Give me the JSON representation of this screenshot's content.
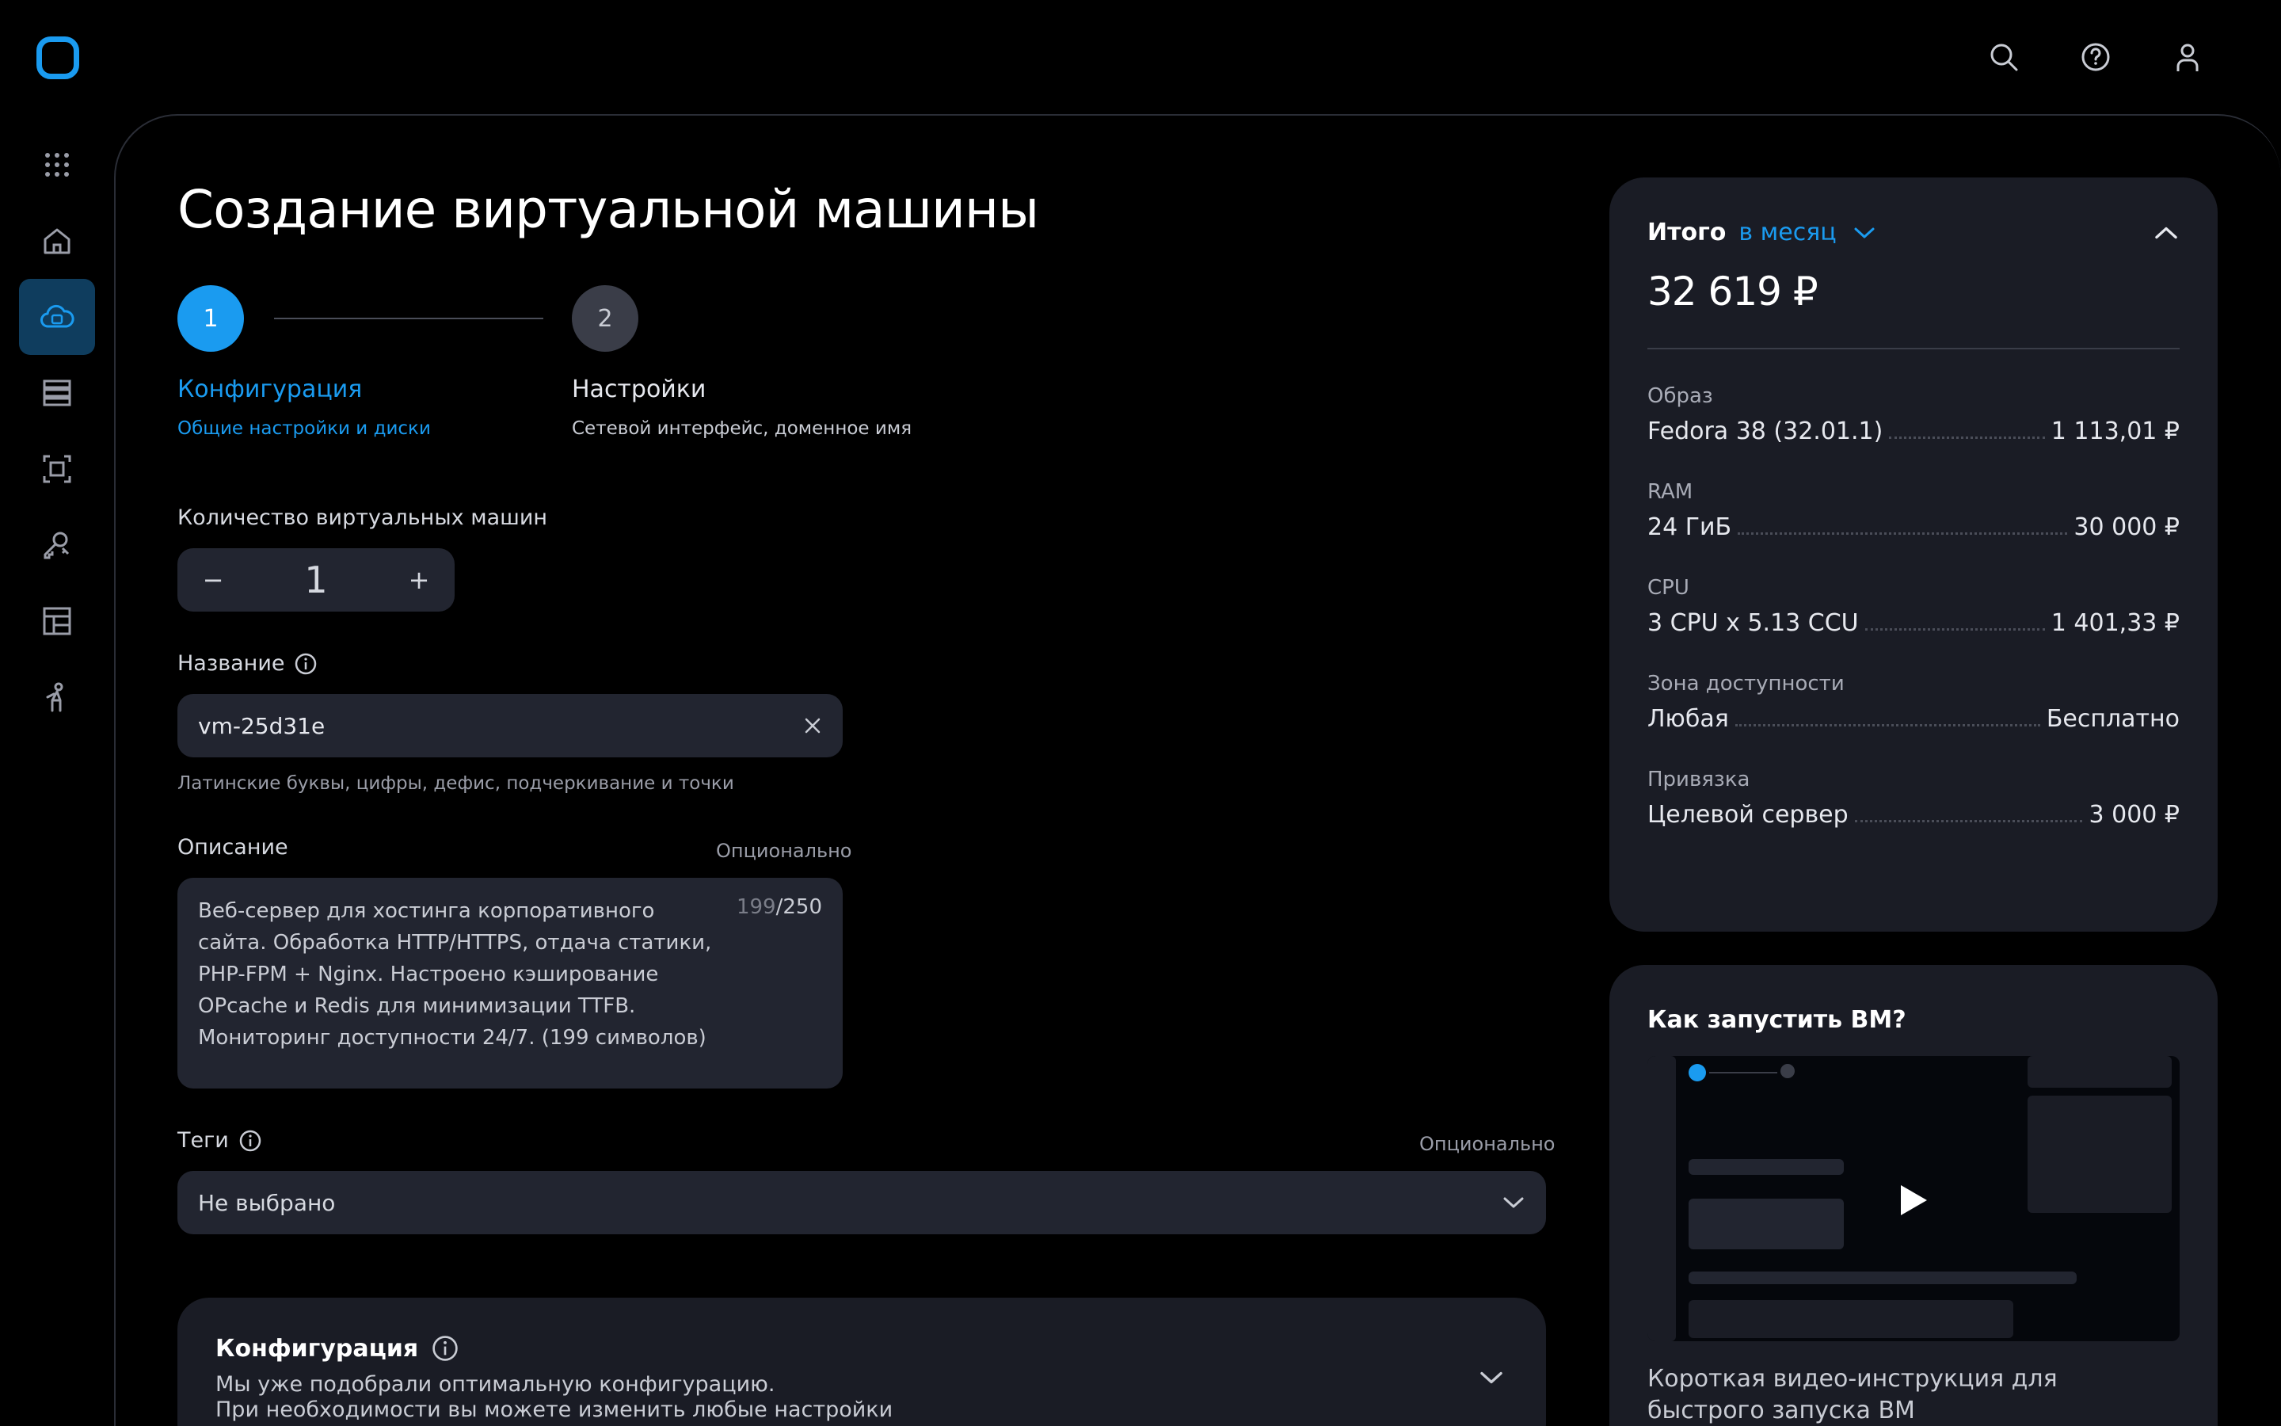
{
  "page": {
    "title": "Создание виртуальной машины"
  },
  "steps": [
    {
      "number": "1",
      "title": "Конфигурация",
      "subtitle": "Общие настройки и диски"
    },
    {
      "number": "2",
      "title": "Настройки",
      "subtitle": "Сетевой интерфейс, доменное имя"
    }
  ],
  "form": {
    "count_label": "Количество виртуальных машин",
    "count_value": "1",
    "minus": "−",
    "plus": "+",
    "name_label": "Название",
    "name_value": "vm-25d31e",
    "name_hint": "Латинские буквы, цифры, дефис, подчеркивание и точки",
    "desc_label": "Описание",
    "desc_optional": "Опционально",
    "desc_value": "Веб-сервер для хостинга корпоративного сайта. Обработка HTTP/HTTPS, отдача статики, PHP-FPM + Nginx. Настроено кэширование OPcache и Redis для минимизации TTFB. Мониторинг доступности 24/7. (199 символов)",
    "desc_count": "199",
    "desc_max": "/250",
    "tags_label": "Теги",
    "tags_optional": "Опционально",
    "tags_value": "Не выбрано"
  },
  "config_card": {
    "title": "Конфигурация",
    "line1": "Мы уже подобрали оптимальную конфигурацию.",
    "line2": "При необходимости вы можете изменить любые настройки"
  },
  "summary": {
    "title": "Итого",
    "period": "в месяц",
    "total": "32 619 ₽",
    "rows": [
      {
        "label": "Образ",
        "name": "Fedora 38 (32.01.1)",
        "price": "1 113,01 ₽"
      },
      {
        "label": "RAM",
        "name": "24 ГиБ",
        "price": "30 000 ₽"
      },
      {
        "label": "CPU",
        "name": "3 CPU x 5.13 CCU",
        "price": "1 401,33 ₽"
      },
      {
        "label": "Зона доступности",
        "name": "Любая",
        "price": "Бесплатно"
      },
      {
        "label": "Привязка",
        "name": "Целевой сервер",
        "price": "3 000 ₽"
      }
    ]
  },
  "video": {
    "title": "Как запустить ВМ?",
    "caption": "Короткая видео-инструкция для быстрого запуска ВМ"
  },
  "icons": {
    "top": [
      "search-icon",
      "help-icon",
      "user-icon"
    ],
    "nav": [
      "apps-grid-icon",
      "home-icon",
      "cloud-icon",
      "servers-icon",
      "frame-icon",
      "keys-icon",
      "layout-icon",
      "support-icon"
    ]
  },
  "colors": {
    "accent": "#1a9bf0",
    "background": "#000000",
    "card": "#1a1c25",
    "field": "#222530",
    "nav_active": "#0f3d5e"
  }
}
